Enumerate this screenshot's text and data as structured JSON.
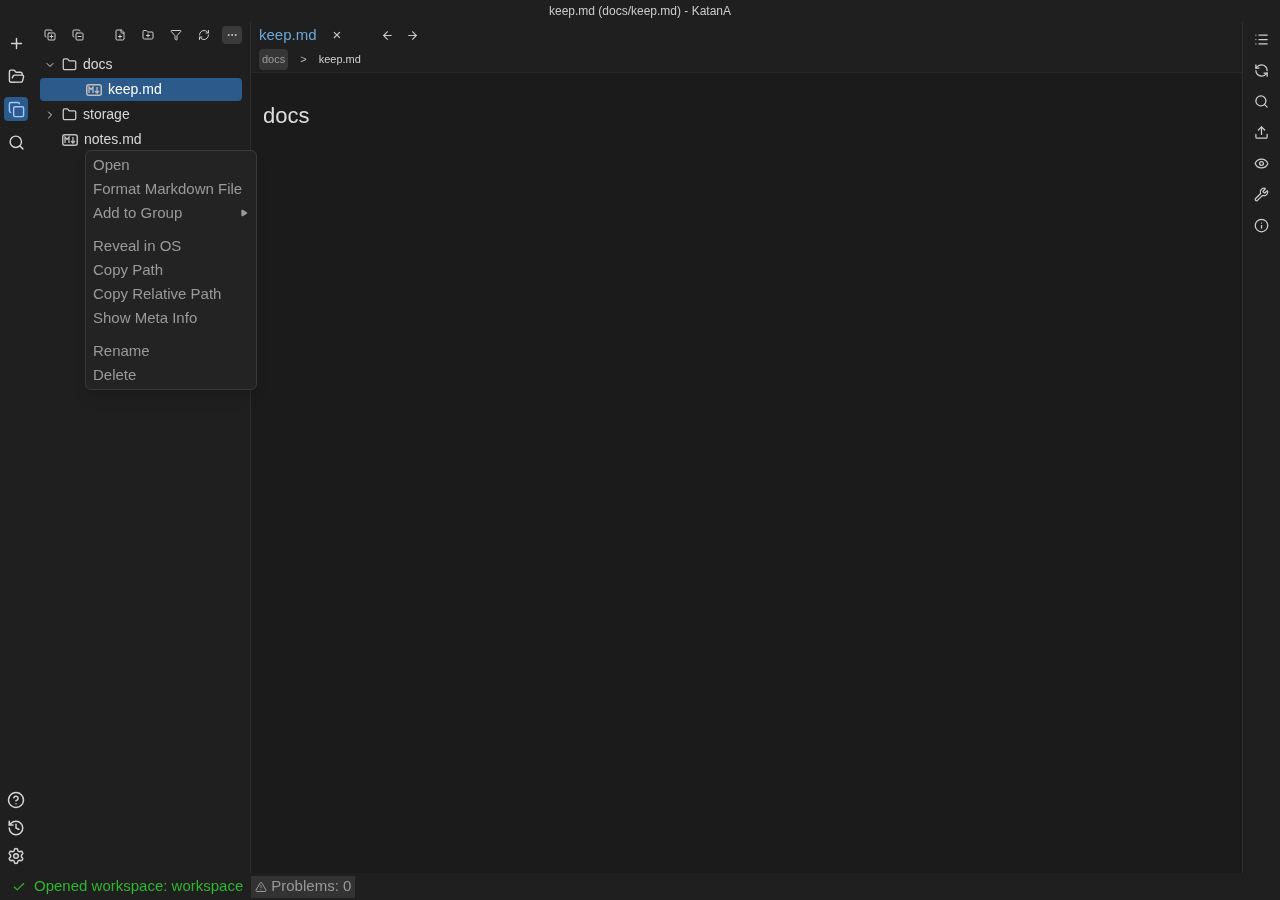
{
  "window": {
    "title": "keep.md (docs/keep.md) - KatanA"
  },
  "activity_bar": {
    "top": [
      {
        "selected": false
      },
      {
        "selected": false
      },
      {
        "selected": true
      },
      {
        "selected": false
      }
    ]
  },
  "explorer_toolbar": [
    {
      "selected": false
    },
    {
      "selected": false
    },
    {
      "selected": false
    },
    {
      "selected": false
    },
    {
      "selected": false
    },
    {
      "selected": false
    },
    {
      "selected": true
    }
  ],
  "tree": [
    {
      "kind": "folder",
      "name": "docs",
      "expanded": true,
      "selected": false,
      "children": [
        {
          "kind": "file",
          "name": "keep.md",
          "selected": true
        }
      ]
    },
    {
      "kind": "folder",
      "name": "storage",
      "expanded": false,
      "selected": false
    },
    {
      "kind": "file",
      "name": "notes.md",
      "selected": false
    }
  ],
  "context_menu": [
    {
      "kind": "item",
      "label": "Open"
    },
    {
      "kind": "item",
      "label": "Format Markdown File"
    },
    {
      "kind": "submenu",
      "label": "Add to Group"
    },
    {
      "kind": "separator"
    },
    {
      "kind": "item",
      "label": "Reveal in OS"
    },
    {
      "kind": "item",
      "label": "Copy Path"
    },
    {
      "kind": "item",
      "label": "Copy Relative Path"
    },
    {
      "kind": "item",
      "label": "Show Meta Info"
    },
    {
      "kind": "separator"
    },
    {
      "kind": "item",
      "label": "Rename"
    },
    {
      "kind": "item",
      "label": "Delete"
    }
  ],
  "tabs": [
    {
      "label": "keep.md",
      "selected": true,
      "close": "×"
    }
  ],
  "breadcrumb": [
    {
      "label": "docs",
      "boxed": true
    },
    {
      "label": "keep.md",
      "boxed": false
    }
  ],
  "breadcrumb_separator": ">",
  "editor": {
    "heading": "docs"
  },
  "status_bar": {
    "message": "Opened workspace: workspace",
    "problems": "Problems: 0"
  }
}
